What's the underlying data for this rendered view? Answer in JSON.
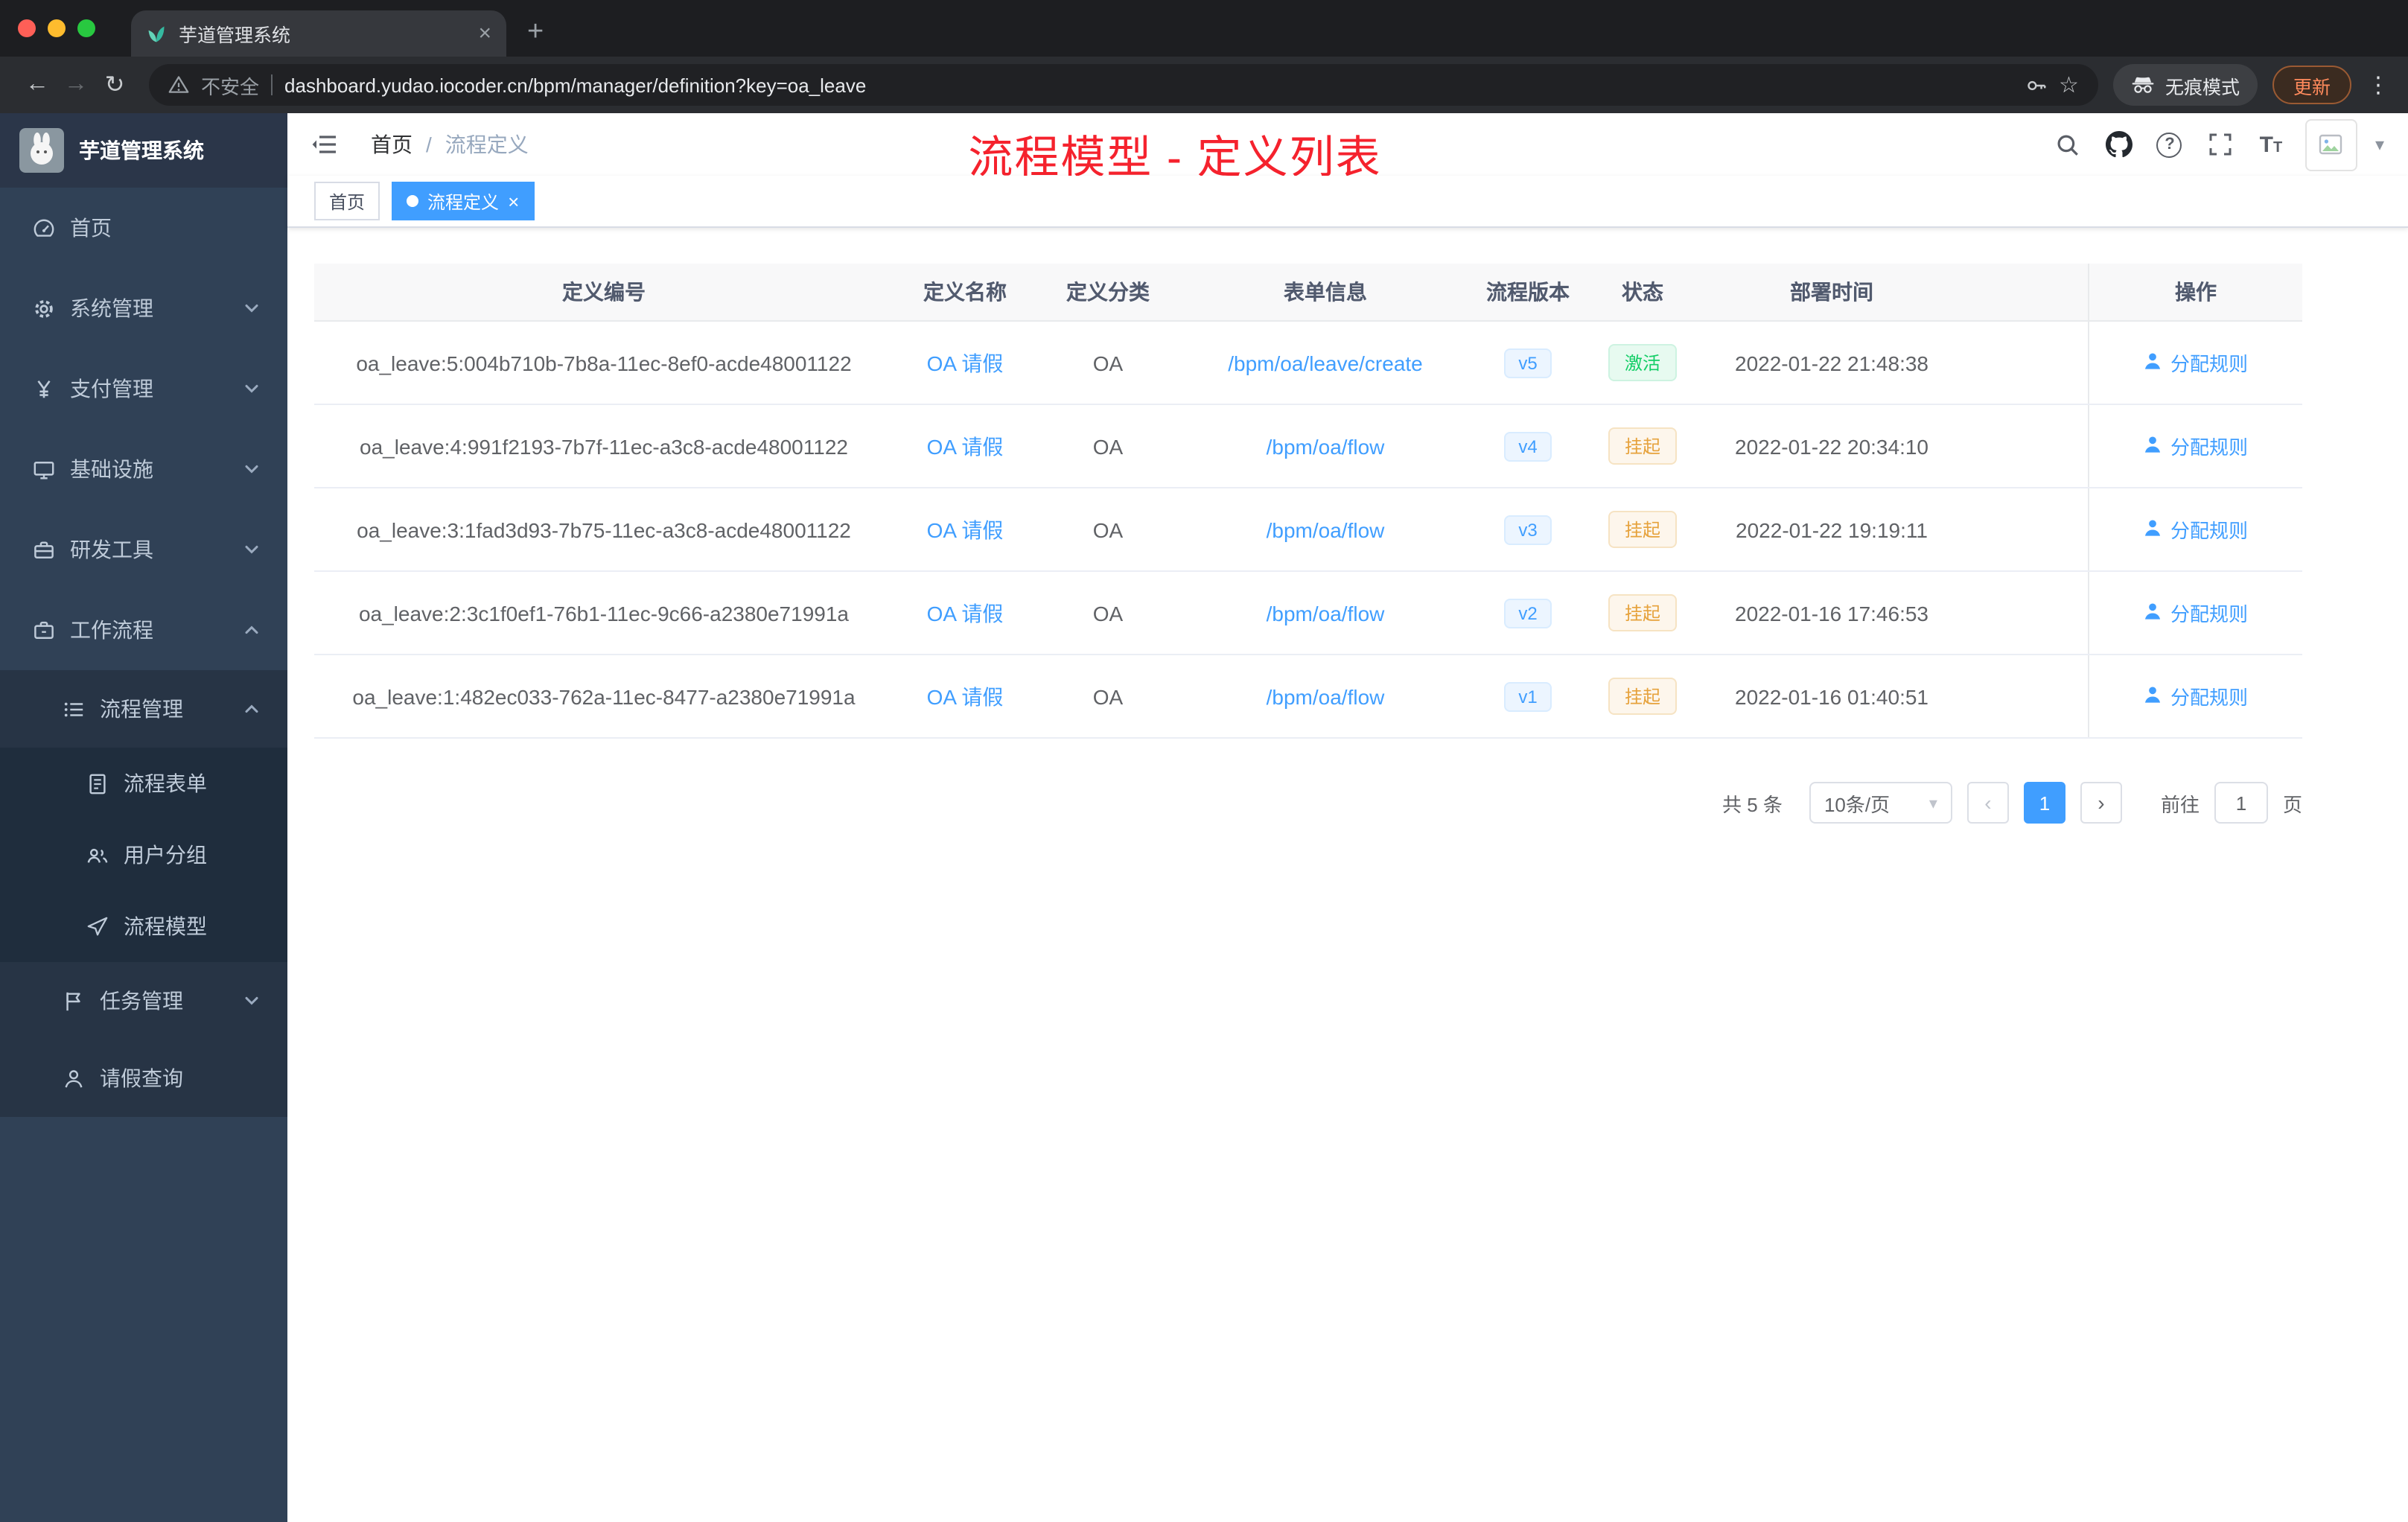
{
  "browser": {
    "tab_title": "芋道管理系统",
    "security_label": "不安全",
    "url": "dashboard.yudao.iocoder.cn/bpm/manager/definition?key=oa_leave",
    "incognito_label": "无痕模式",
    "update_label": "更新"
  },
  "sidebar": {
    "logo_title": "芋道管理系统",
    "items": [
      {
        "key": "home",
        "label": "首页",
        "icon": "dashboard-icon",
        "level": 1,
        "arrow": null
      },
      {
        "key": "system-mgmt",
        "label": "系统管理",
        "icon": "gear-icon",
        "level": 1,
        "arrow": "down"
      },
      {
        "key": "payment-mgmt",
        "label": "支付管理",
        "icon": "yen-icon",
        "level": 1,
        "arrow": "down"
      },
      {
        "key": "infrastructure",
        "label": "基础设施",
        "icon": "monitor-icon",
        "level": 1,
        "arrow": "down"
      },
      {
        "key": "dev-tools",
        "label": "研发工具",
        "icon": "toolbox-icon",
        "level": 1,
        "arrow": "down"
      },
      {
        "key": "workflow",
        "label": "工作流程",
        "icon": "briefcase-icon",
        "level": 1,
        "arrow": "up"
      },
      {
        "key": "process-mgmt",
        "label": "流程管理",
        "icon": "list-icon",
        "level": 2,
        "arrow": "up"
      },
      {
        "key": "process-form",
        "label": "流程表单",
        "icon": "form-icon",
        "level": 3,
        "arrow": null
      },
      {
        "key": "user-group",
        "label": "用户分组",
        "icon": "users-icon",
        "level": 3,
        "arrow": null
      },
      {
        "key": "process-model",
        "label": "流程模型",
        "icon": "plane-icon",
        "level": 3,
        "arrow": null
      },
      {
        "key": "task-mgmt",
        "label": "任务管理",
        "icon": "flag-icon",
        "level": 2,
        "arrow": "down"
      },
      {
        "key": "leave-query",
        "label": "请假查询",
        "icon": "user-icon",
        "level": 2,
        "arrow": null
      }
    ]
  },
  "header": {
    "breadcrumb": {
      "home": "首页",
      "separator": "/",
      "current": "流程定义"
    },
    "annotation": "流程模型 - 定义列表"
  },
  "tags": [
    {
      "label": "首页",
      "active": false,
      "closable": false
    },
    {
      "label": "流程定义",
      "active": true,
      "closable": true
    }
  ],
  "table": {
    "columns": [
      "定义编号",
      "定义名称",
      "定义分类",
      "表单信息",
      "流程版本",
      "状态",
      "部署时间",
      "操作"
    ],
    "rows": [
      {
        "id": "oa_leave:5:004b710b-7b8a-11ec-8ef0-acde48001122",
        "name": "OA 请假",
        "category": "OA",
        "form": "/bpm/oa/leave/create",
        "version": "v5",
        "status": "激活",
        "status_type": "success",
        "time": "2022-01-22 21:48:38",
        "action": "分配规则"
      },
      {
        "id": "oa_leave:4:991f2193-7b7f-11ec-a3c8-acde48001122",
        "name": "OA 请假",
        "category": "OA",
        "form": "/bpm/oa/flow",
        "version": "v4",
        "status": "挂起",
        "status_type": "warning",
        "time": "2022-01-22 20:34:10",
        "action": "分配规则"
      },
      {
        "id": "oa_leave:3:1fad3d93-7b75-11ec-a3c8-acde48001122",
        "name": "OA 请假",
        "category": "OA",
        "form": "/bpm/oa/flow",
        "version": "v3",
        "status": "挂起",
        "status_type": "warning",
        "time": "2022-01-22 19:19:11",
        "action": "分配规则"
      },
      {
        "id": "oa_leave:2:3c1f0ef1-76b1-11ec-9c66-a2380e71991a",
        "name": "OA 请假",
        "category": "OA",
        "form": "/bpm/oa/flow",
        "version": "v2",
        "status": "挂起",
        "status_type": "warning",
        "time": "2022-01-16 17:46:53",
        "action": "分配规则"
      },
      {
        "id": "oa_leave:1:482ec033-762a-11ec-8477-a2380e71991a",
        "name": "OA 请假",
        "category": "OA",
        "form": "/bpm/oa/flow",
        "version": "v1",
        "status": "挂起",
        "status_type": "warning",
        "time": "2022-01-16 01:40:51",
        "action": "分配规则"
      }
    ]
  },
  "pagination": {
    "total": "共 5 条",
    "page_size": "10条/页",
    "current": "1",
    "goto_prefix": "前往",
    "goto_value": "1",
    "goto_suffix": "页"
  },
  "colors": {
    "accent": "#409eff",
    "annotation": "#f5222d",
    "success": "#13ce66",
    "warning": "#e6a23c",
    "sidebar_bg": "#304156"
  }
}
